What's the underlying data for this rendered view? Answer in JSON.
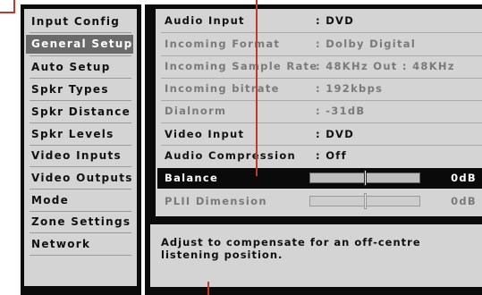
{
  "menu": {
    "items": [
      {
        "label": "Input Config",
        "selected": false
      },
      {
        "label": "General Setup",
        "selected": true
      },
      {
        "label": "Auto Setup",
        "selected": false
      },
      {
        "label": "Spkr Types",
        "selected": false
      },
      {
        "label": "Spkr Distance",
        "selected": false
      },
      {
        "label": "Spkr Levels",
        "selected": false
      },
      {
        "label": "Video Inputs",
        "selected": false
      },
      {
        "label": "Video Outputs",
        "selected": false
      },
      {
        "label": "Mode",
        "selected": false
      },
      {
        "label": "Zone Settings",
        "selected": false
      },
      {
        "label": "Network",
        "selected": false
      }
    ]
  },
  "settings": {
    "rows": [
      {
        "label": "Audio Input",
        "value": ": DVD",
        "style": "dark"
      },
      {
        "label": "Incoming Format",
        "value": ": Dolby Digital",
        "style": "dim"
      },
      {
        "label": "Incoming Sample Rate",
        "value": ": 48KHz Out : 48KHz",
        "style": "dim"
      },
      {
        "label": "Incoming bitrate",
        "value": ": 192kbps",
        "style": "dim"
      },
      {
        "label": "Dialnorm",
        "value": ": -31dB",
        "style": "dim"
      },
      {
        "label": "Video Input",
        "value": ": DVD",
        "style": "dark"
      },
      {
        "label": "Audio Compression",
        "value": ": Off",
        "style": "dark"
      }
    ],
    "balance": {
      "label": "Balance",
      "value": "0dB",
      "position": 0.5
    },
    "pl2_dimension": {
      "label": "PLII Dimension",
      "value": "0dB",
      "position": 0.5
    }
  },
  "help": {
    "text": "Adjust to compensate for an off-centre listening position."
  },
  "colors": {
    "annotation_line": "#c0392b",
    "selected_row": "#0a0a0a",
    "menu_selected": "#6a6a6a"
  }
}
